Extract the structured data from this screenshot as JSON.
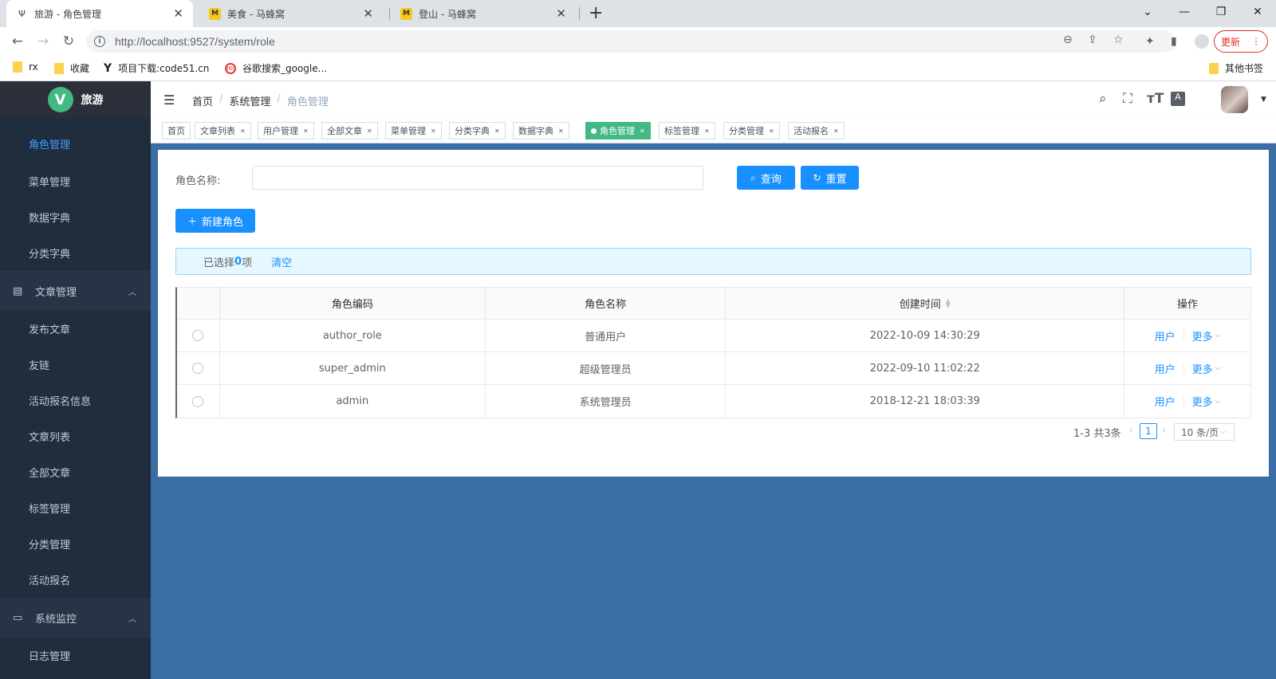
{
  "browser": {
    "tabs": [
      {
        "title": "旅游 - 角色管理",
        "favicon": "tree-icon"
      },
      {
        "title": "美食 - 马蜂窝",
        "favicon": "mafengwo-icon"
      },
      {
        "title": "登山 - 马蜂窝",
        "favicon": "mafengwo-icon"
      }
    ],
    "url": "http://localhost:9527/system/role",
    "update_label": "更新",
    "bookmarks": [
      "rx",
      "收藏",
      "项目下载:code51.cn",
      "谷歌搜索_google..."
    ],
    "other_bookmarks": "其他书签"
  },
  "sidebar": {
    "logo_text": "旅游",
    "logo_letter": "V",
    "items_top": [
      "角色管理",
      "菜单管理",
      "数据字典",
      "分类字典"
    ],
    "group_article": "文章管理",
    "items_article": [
      "发布文章",
      "友链",
      "活动报名信息",
      "文章列表",
      "全部文章",
      "标签管理",
      "分类管理",
      "活动报名"
    ],
    "group_monitor": "系统监控",
    "items_monitor": [
      "日志管理"
    ]
  },
  "navbar": {
    "breadcrumb": [
      "首页",
      "系统管理",
      "角色管理"
    ]
  },
  "tags": [
    "首页",
    "文章列表",
    "用户管理",
    "全部文章",
    "菜单管理",
    "分类字典",
    "数据字典",
    "角色管理",
    "标签管理",
    "分类管理",
    "活动报名"
  ],
  "search": {
    "label": "角色名称:",
    "value": "",
    "query_label": "查询",
    "reset_label": "重置"
  },
  "new_role_label": "新建角色",
  "selection": {
    "prefix": "已选择 ",
    "count": "0",
    "suffix": "项",
    "clear_label": "清空"
  },
  "table": {
    "columns": [
      "角色编码",
      "角色名称",
      "创建时间",
      "操作"
    ],
    "rows": [
      {
        "code": "author_role",
        "name": "普通用户",
        "created": "2022-10-09 14:30:29",
        "op_user": "用户",
        "op_more": "更多"
      },
      {
        "code": "super_admin",
        "name": "超级管理员",
        "created": "2022-09-10 11:02:22",
        "op_user": "用户",
        "op_more": "更多"
      },
      {
        "code": "admin",
        "name": "系统管理员",
        "created": "2018-12-21 18:03:39",
        "op_user": "用户",
        "op_more": "更多"
      }
    ]
  },
  "pagination": {
    "total_text": "1-3 共3条",
    "current_page": "1",
    "page_size": "10 条/页"
  },
  "colors": {
    "primary": "#1890ff",
    "sidebar_bg": "#1f2d3d",
    "active_tag": "#42b983",
    "main_bg": "#3c6ea6"
  }
}
